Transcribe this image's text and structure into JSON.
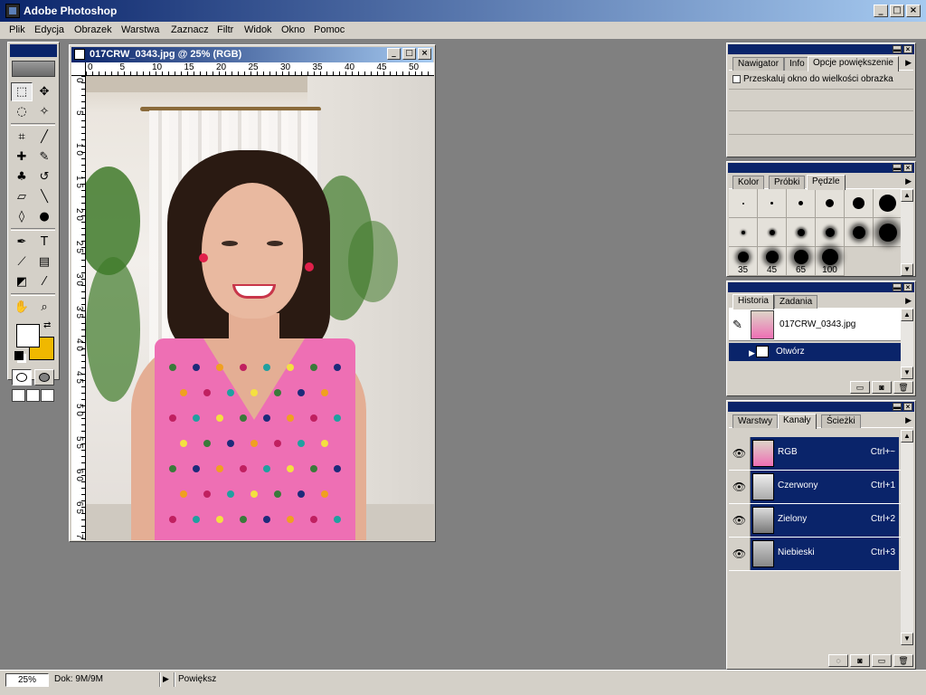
{
  "app": {
    "title": "Adobe Photoshop"
  },
  "window_controls": {
    "minimize": "_",
    "maximize": "□",
    "close": "×"
  },
  "menu": [
    "Plik",
    "Edycja",
    "Obrazek",
    "Warstwa",
    "Zaznacz",
    "Filtr",
    "Widok",
    "Okno",
    "Pomoc"
  ],
  "document": {
    "title": "017CRW_0343.jpg @ 25% (RGB)",
    "ruler_top": [
      "0",
      "5",
      "10",
      "15",
      "20",
      "25",
      "30",
      "35",
      "40",
      "45",
      "50"
    ],
    "ruler_left": [
      "0",
      "5",
      "1 0",
      "1 5",
      "2 0",
      "2 5",
      "3 0",
      "3 5",
      "4 0",
      "4 5",
      "5 0",
      "5 5",
      "6 0",
      "6 5",
      "7 0"
    ]
  },
  "toolbox": {
    "tools": [
      {
        "name": "marquee-tool",
        "glyph": "⬚"
      },
      {
        "name": "move-tool",
        "glyph": "✥"
      },
      {
        "name": "lasso-tool",
        "glyph": "◌"
      },
      {
        "name": "magic-wand-tool",
        "glyph": "✧"
      },
      {
        "name": "crop-tool",
        "glyph": "⌗"
      },
      {
        "name": "slice-tool",
        "glyph": "╱"
      },
      {
        "name": "healing-tool",
        "glyph": "✚"
      },
      {
        "name": "brush-tool",
        "glyph": "✎"
      },
      {
        "name": "stamp-tool",
        "glyph": "♣"
      },
      {
        "name": "history-brush-tool",
        "glyph": "↺"
      },
      {
        "name": "eraser-tool",
        "glyph": "▱"
      },
      {
        "name": "line-tool",
        "glyph": "╲"
      },
      {
        "name": "blur-tool",
        "glyph": "◊"
      },
      {
        "name": "dodge-tool",
        "glyph": "●"
      },
      {
        "name": "pen-tool",
        "glyph": "✒"
      },
      {
        "name": "type-tool",
        "glyph": "T"
      },
      {
        "name": "measure-tool",
        "glyph": "⟋"
      },
      {
        "name": "gradient-tool",
        "glyph": "▤"
      },
      {
        "name": "bucket-tool",
        "glyph": "◩"
      },
      {
        "name": "eyedropper-tool",
        "glyph": "⁄"
      },
      {
        "name": "hand-tool",
        "glyph": "✋"
      },
      {
        "name": "zoom-tool",
        "glyph": "⌕"
      }
    ],
    "colors": {
      "foreground": "#ffffff",
      "background": "#f0b800"
    }
  },
  "navigator_panel": {
    "tabs": [
      "Nawigator",
      "Info",
      "Opcje powiększenie"
    ],
    "checkbox_label": "Przeskaluj okno do wielkości obrazka"
  },
  "brushes_panel": {
    "tabs": [
      "Kolor",
      "Próbki",
      "Pędzle"
    ],
    "brushes": [
      {
        "size": 2,
        "label": ""
      },
      {
        "size": 3,
        "label": ""
      },
      {
        "size": 5,
        "label": ""
      },
      {
        "size": 9,
        "label": ""
      },
      {
        "size": 13,
        "label": ""
      },
      {
        "size": 19,
        "label": ""
      },
      {
        "size": 4,
        "label": "",
        "soft": true
      },
      {
        "size": 6,
        "label": "",
        "soft": true
      },
      {
        "size": 8,
        "label": "",
        "soft": true
      },
      {
        "size": 10,
        "label": "",
        "soft": true
      },
      {
        "size": 14,
        "label": "",
        "soft": true
      },
      {
        "size": 20,
        "label": "",
        "soft": true
      },
      {
        "size": 12,
        "label": "35",
        "soft": true
      },
      {
        "size": 14,
        "label": "45",
        "soft": true
      },
      {
        "size": 16,
        "label": "65",
        "soft": true
      },
      {
        "size": 18,
        "label": "100",
        "soft": true
      }
    ]
  },
  "history_panel": {
    "tabs": [
      "Historia",
      "Zadania"
    ],
    "snapshot_label": "017CRW_0343.jpg",
    "state_label": "Otwórz"
  },
  "channels_panel": {
    "tabs": [
      "Warstwy",
      "Kanały",
      "Ścieżki"
    ],
    "channels": [
      {
        "name": "RGB",
        "shortcut": "Ctrl+~"
      },
      {
        "name": "Czerwony",
        "shortcut": "Ctrl+1"
      },
      {
        "name": "Zielony",
        "shortcut": "Ctrl+2"
      },
      {
        "name": "Niebieski",
        "shortcut": "Ctrl+3"
      }
    ]
  },
  "status": {
    "zoom": "25%",
    "doc": "Dok: 9M/9M",
    "hint": "Powiększ"
  },
  "colors": {
    "title_blue": "#0a246a",
    "panel_gray": "#d4d0c8",
    "workspace": "#808080",
    "dress_pink": "#ee6fb4"
  }
}
